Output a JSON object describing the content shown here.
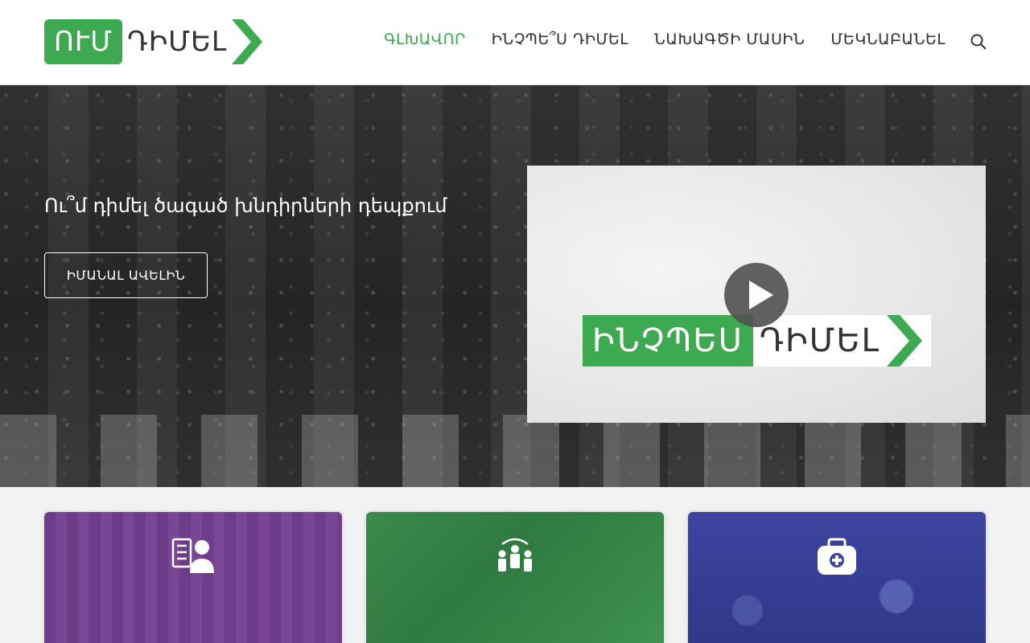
{
  "logo": {
    "box_text": "ՈՒՄ",
    "text": "ԴԻՄԵԼ"
  },
  "nav": {
    "items": [
      {
        "label": "ԳԼԽԱՎՈՐ",
        "active": true
      },
      {
        "label": "ԻՆՉՊԵ՞Ս ԴԻՄԵԼ",
        "active": false
      },
      {
        "label": "ՆԱԽԱԳԾԻ ՄԱՍԻՆ",
        "active": false
      },
      {
        "label": "ՄԵԿՆԱԲԱՆԵԼ",
        "active": false
      }
    ],
    "search_icon": "search-icon"
  },
  "hero": {
    "title": "Ու՞մ դիմել ծագած խնդիրների դեպքում",
    "button_label": "ԻՄԱՆԱԼ ԱՎԵԼԻՆ"
  },
  "video": {
    "logo_box_text": "ԻՆՉՊԵՍ",
    "logo_text": "ԴԻՄԵԼ",
    "play_icon": "play-icon"
  },
  "cards": [
    {
      "icon": "checklist-person-icon",
      "color": "#6e3d8a"
    },
    {
      "icon": "group-people-icon",
      "color": "#3c8a4c"
    },
    {
      "icon": "medical-kit-icon",
      "color": "#3d45a0"
    }
  ],
  "colors": {
    "accent": "#3da950",
    "text": "#333333"
  }
}
